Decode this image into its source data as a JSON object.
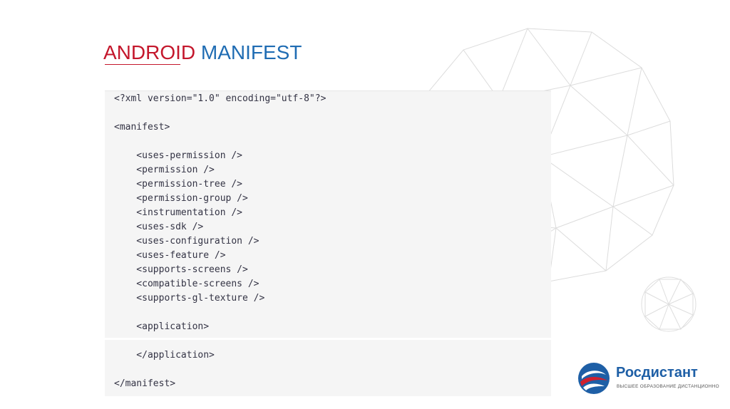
{
  "title": {
    "part1": "ANDROID",
    "part2": " MANIFEST"
  },
  "code_lines": [
    "<?xml version=\"1.0\" encoding=\"utf-8\"?>",
    "",
    "<manifest>",
    "",
    "    <uses-permission />",
    "    <permission />",
    "    <permission-tree />",
    "    <permission-group />",
    "    <instrumentation />",
    "    <uses-sdk />",
    "    <uses-configuration />",
    "    <uses-feature />",
    "    <supports-screens />",
    "    <compatible-screens />",
    "    <supports-gl-texture />",
    "",
    "    <application>",
    "",
    "    </application>",
    "",
    "</manifest>"
  ],
  "logo": {
    "name": "Росдистант",
    "subtitle": "ВЫСШЕЕ ОБРАЗОВАНИЕ ДИСТАНЦИОННО"
  },
  "colors": {
    "title_red": "#c4172c",
    "title_blue": "#1f6cb3",
    "logo_blue": "#1e5fa6",
    "logo_red": "#d0202e"
  }
}
